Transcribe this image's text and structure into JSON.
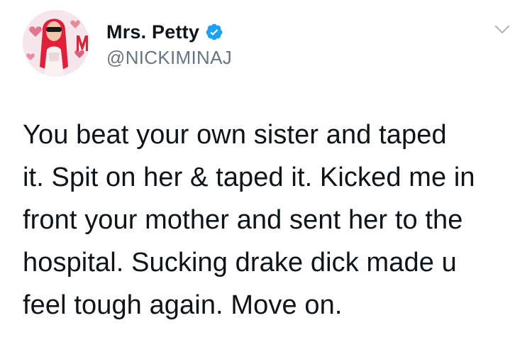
{
  "author": {
    "display_name": "Mrs. Petty",
    "handle": "@NICKIMINAJ",
    "verified": true,
    "avatar_icon": "profile-photo"
  },
  "tweet": {
    "lines": [
      "You beat your own sister and taped",
      "it. Spit on her & taped it. Kicked me in",
      "front your mother and sent her to the",
      "hospital. Sucking drake dick made u",
      "feel tough again. Move on."
    ]
  },
  "icons": {
    "verified": "verified-badge-icon",
    "more": "chevron-down-icon"
  },
  "colors": {
    "text": "#0f1419",
    "secondary": "#66757f",
    "verified_blue": "#1da1f2",
    "chevron": "#aab8c2"
  }
}
